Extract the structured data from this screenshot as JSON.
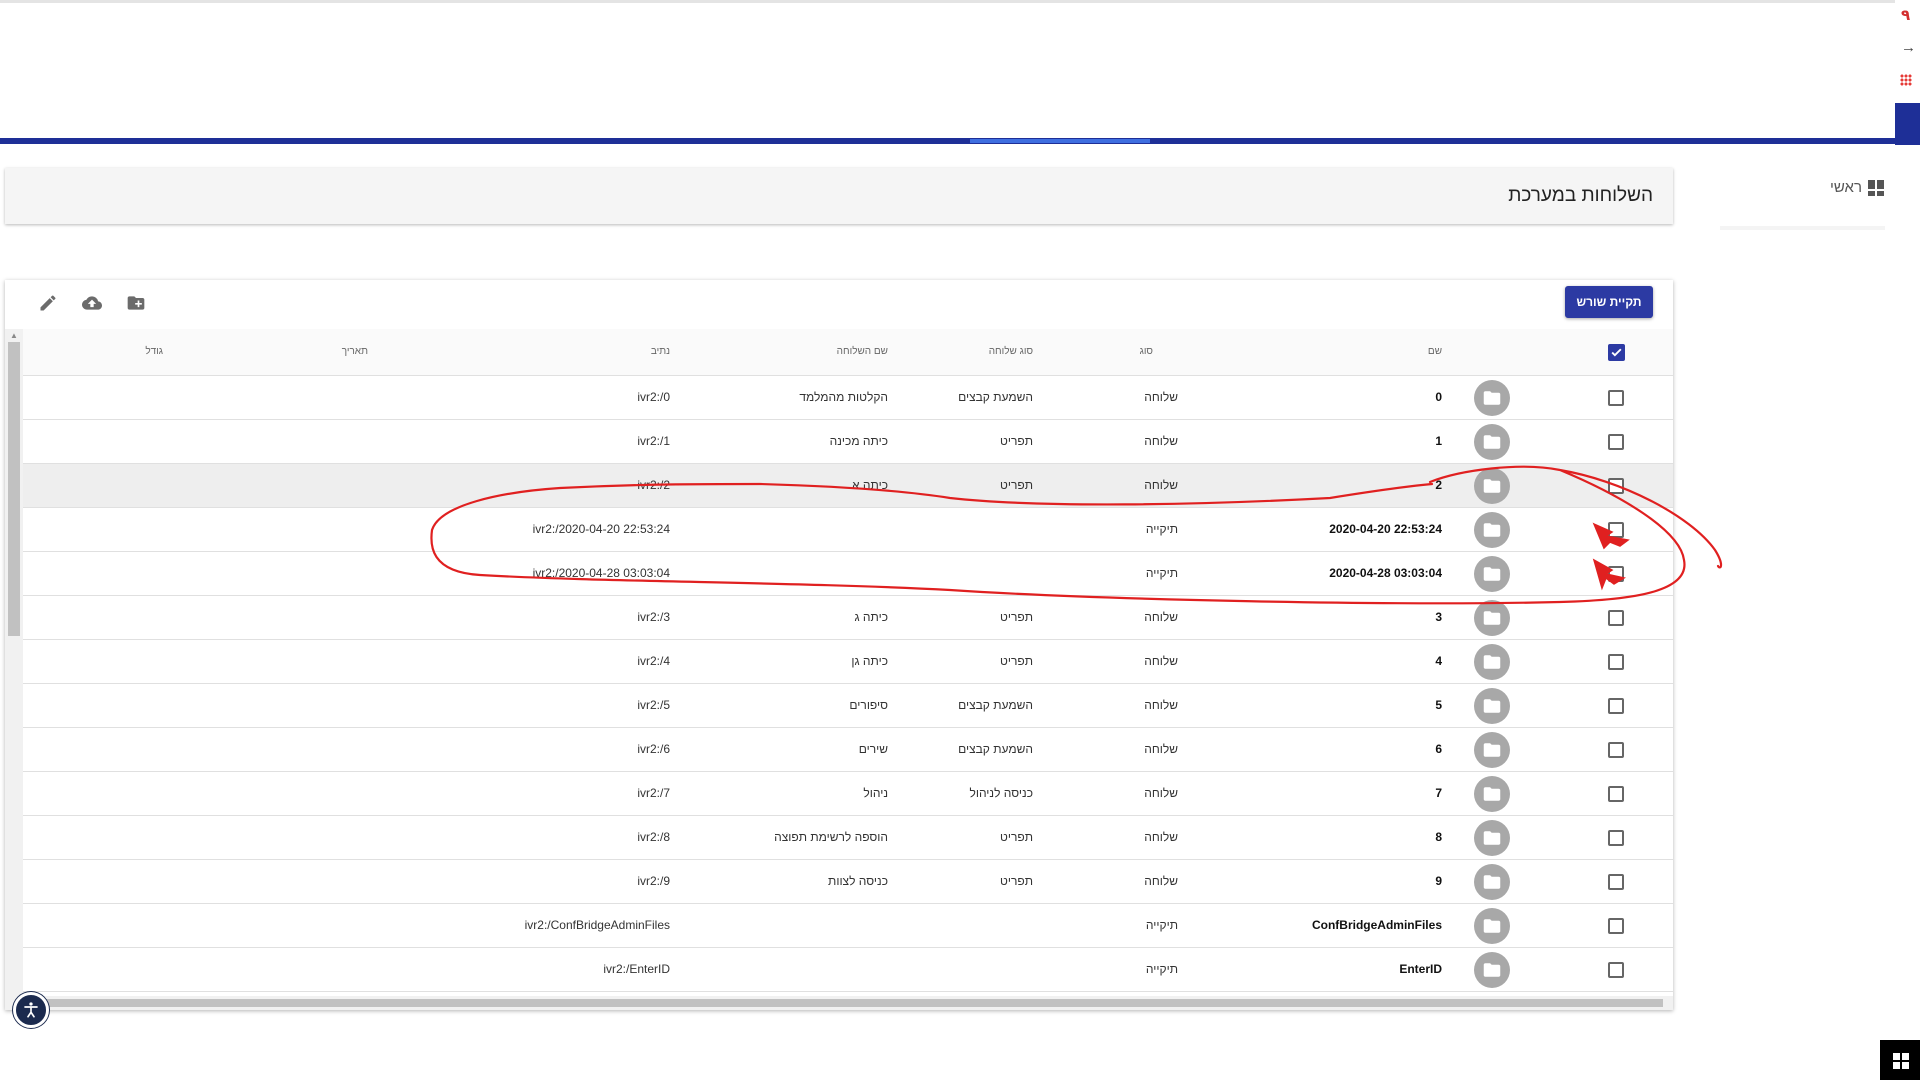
{
  "sidebar": {
    "home_label": "ראשי",
    "home_icon": "dashboard-icon"
  },
  "page": {
    "title": "השלוחות במערכת"
  },
  "toolbar": {
    "root_button": "תקיית שורש",
    "icons": [
      "edit-icon",
      "cloud-upload-icon",
      "create-folder-icon"
    ]
  },
  "table": {
    "columns": {
      "name": "שם",
      "type": "סוג",
      "extension_type": "סוג שלוחה",
      "extension_name": "שם השלוחה",
      "path": "נתיב",
      "date": "תאריך",
      "size": "גודל"
    },
    "select_all_checked": true,
    "rows": [
      {
        "name": "0",
        "type": "שלוחה",
        "extension_type": "השמעת קבצים",
        "extension_name": "הקלטות מהמלמד",
        "path": "ivr2:/0",
        "date": "",
        "size": ""
      },
      {
        "name": "1",
        "type": "שלוחה",
        "extension_type": "תפריט",
        "extension_name": "כיתה מכינה",
        "path": "ivr2:/1",
        "date": "",
        "size": ""
      },
      {
        "name": "2",
        "type": "שלוחה",
        "extension_type": "תפריט",
        "extension_name": "כיתה א",
        "path": "ivr2:/2",
        "date": "",
        "size": ""
      },
      {
        "name": "2020-04-20 22:53:24",
        "type": "תיקייה",
        "extension_type": "",
        "extension_name": "",
        "path": "ivr2:/2020-04-20 22:53:24",
        "date": "",
        "size": ""
      },
      {
        "name": "2020-04-28 03:03:04",
        "type": "תיקייה",
        "extension_type": "",
        "extension_name": "",
        "path": "ivr2:/2020-04-28 03:03:04",
        "date": "",
        "size": ""
      },
      {
        "name": "3",
        "type": "שלוחה",
        "extension_type": "תפריט",
        "extension_name": "כיתה ג",
        "path": "ivr2:/3",
        "date": "",
        "size": ""
      },
      {
        "name": "4",
        "type": "שלוחה",
        "extension_type": "תפריט",
        "extension_name": "כיתה גן",
        "path": "ivr2:/4",
        "date": "",
        "size": ""
      },
      {
        "name": "5",
        "type": "שלוחה",
        "extension_type": "השמעת קבצים",
        "extension_name": "סיפורים",
        "path": "ivr2:/5",
        "date": "",
        "size": ""
      },
      {
        "name": "6",
        "type": "שלוחה",
        "extension_type": "השמעת קבצים",
        "extension_name": "שירים",
        "path": "ivr2:/6",
        "date": "",
        "size": ""
      },
      {
        "name": "7",
        "type": "שלוחה",
        "extension_type": "כניסה לניהול",
        "extension_name": "ניהול",
        "path": "ivr2:/7",
        "date": "",
        "size": ""
      },
      {
        "name": "8",
        "type": "שלוחה",
        "extension_type": "תפריט",
        "extension_name": "הוספה לרשימת תפוצה",
        "path": "ivr2:/8",
        "date": "",
        "size": ""
      },
      {
        "name": "9",
        "type": "שלוחה",
        "extension_type": "תפריט",
        "extension_name": "כניסה לצוות",
        "path": "ivr2:/9",
        "date": "",
        "size": ""
      },
      {
        "name": "ConfBridgeAdminFiles",
        "type": "תיקייה",
        "extension_type": "",
        "extension_name": "",
        "path": "ivr2:/ConfBridgeAdminFiles",
        "date": "",
        "size": ""
      },
      {
        "name": "EnterID",
        "type": "תיקייה",
        "extension_type": "",
        "extension_name": "",
        "path": "ivr2:/EnterID",
        "date": "",
        "size": ""
      }
    ]
  },
  "colors": {
    "primary": "#2c3aa3",
    "nav_band": "#1e2f97",
    "annotation": "#e02020",
    "folder_badge": "#a8a8a8"
  }
}
